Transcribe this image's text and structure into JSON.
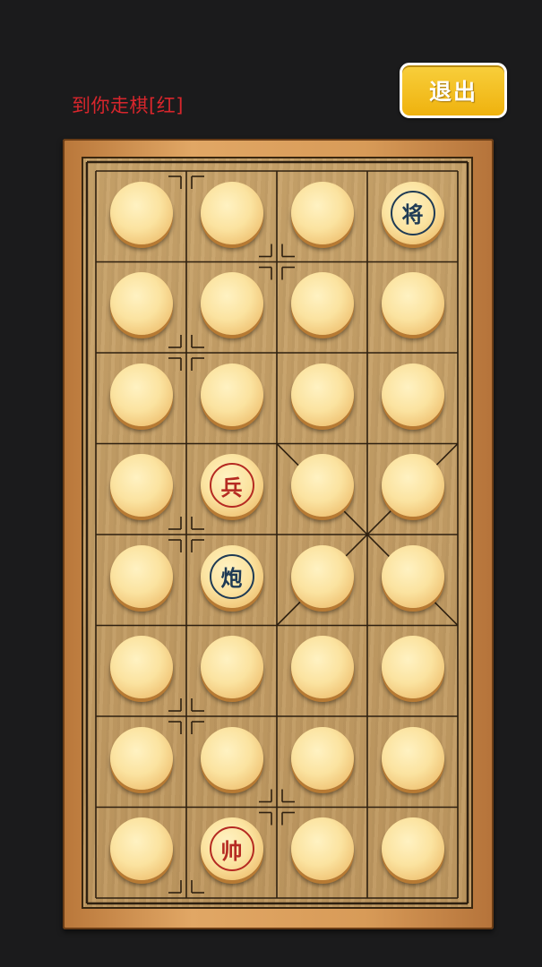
{
  "status": {
    "turn_text": "到你走棋[红]"
  },
  "toolbar": {
    "exit_label": "退出"
  },
  "colors": {
    "red": "#b52a22",
    "black": "#1f3b55",
    "status_text": "#d8262c",
    "exit_button": "#f5c125"
  },
  "board": {
    "rows": 8,
    "cols": 4,
    "cells": [
      [
        {
          "state": "hidden"
        },
        {
          "state": "hidden"
        },
        {
          "state": "hidden"
        },
        {
          "state": "revealed",
          "side": "black",
          "char": "将"
        }
      ],
      [
        {
          "state": "hidden"
        },
        {
          "state": "hidden"
        },
        {
          "state": "hidden"
        },
        {
          "state": "hidden"
        }
      ],
      [
        {
          "state": "hidden"
        },
        {
          "state": "hidden"
        },
        {
          "state": "hidden"
        },
        {
          "state": "hidden"
        }
      ],
      [
        {
          "state": "hidden"
        },
        {
          "state": "revealed",
          "side": "red",
          "char": "兵"
        },
        {
          "state": "hidden"
        },
        {
          "state": "hidden"
        }
      ],
      [
        {
          "state": "hidden"
        },
        {
          "state": "revealed",
          "side": "black",
          "char": "炮"
        },
        {
          "state": "hidden"
        },
        {
          "state": "hidden"
        }
      ],
      [
        {
          "state": "hidden"
        },
        {
          "state": "hidden"
        },
        {
          "state": "hidden"
        },
        {
          "state": "hidden"
        }
      ],
      [
        {
          "state": "hidden"
        },
        {
          "state": "hidden"
        },
        {
          "state": "hidden"
        },
        {
          "state": "hidden"
        }
      ],
      [
        {
          "state": "hidden"
        },
        {
          "state": "revealed",
          "side": "red",
          "char": "帅"
        },
        {
          "state": "hidden"
        },
        {
          "state": "hidden"
        }
      ]
    ]
  }
}
